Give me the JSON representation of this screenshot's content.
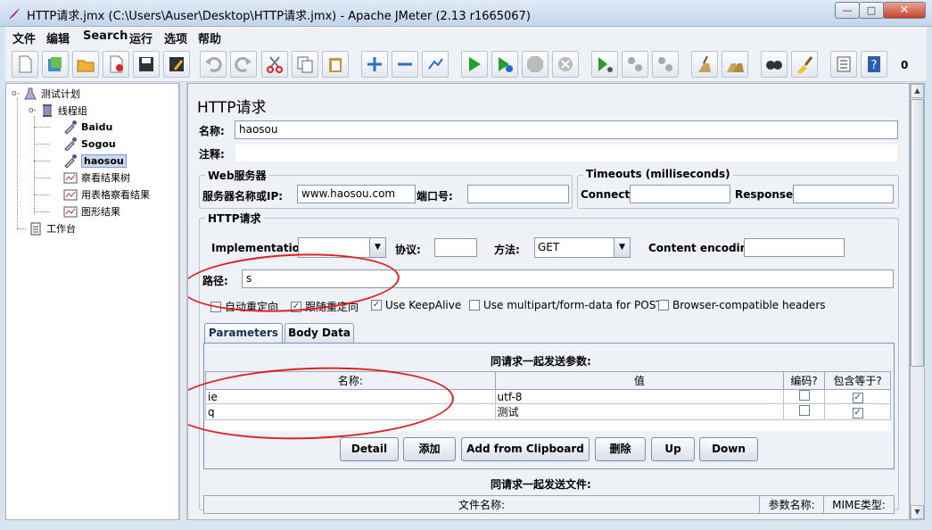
{
  "window": {
    "title": "HTTP请求.jmx (C:\\Users\\Auser\\Desktop\\HTTP请求.jmx) - Apache JMeter (2.13 r1665067)",
    "minimize": "—",
    "maximize": "□",
    "close": "✕"
  },
  "menu": [
    "文件",
    "编辑",
    "Search",
    "运行",
    "选项",
    "帮助"
  ],
  "toolbar": {
    "icons": [
      "new-icon",
      "templates-icon",
      "open-icon",
      "close-icon",
      "save-icon",
      "save-as-icon",
      "undo-icon",
      "redo-icon",
      "cut-icon",
      "copy-icon",
      "paste-icon",
      "expand-icon",
      "collapse-icon",
      "toggle-icon",
      "start-icon",
      "start-no-pause-icon",
      "stop-icon",
      "shutdown-icon",
      "remote-start-icon",
      "remote-stop-icon",
      "remote-shutdown-icon",
      "clear-icon",
      "clear-all-icon",
      "search-icon",
      "reset-search-icon",
      "function-helper-icon",
      "help-icon"
    ],
    "error_count": "0"
  },
  "tree": {
    "test_plan": "测试计划",
    "thread_group": "线程组",
    "samplers": [
      "Baidu",
      "Sogou",
      "haosou"
    ],
    "listeners": [
      "察看结果树",
      "用表格察看结果",
      "图形结果"
    ],
    "workbench": "工作台"
  },
  "panel": {
    "heading": "HTTP请求",
    "name_label": "名称:",
    "name_value": "haosou",
    "comment_label": "注释:",
    "comment_value": "",
    "web_server": {
      "legend": "Web服务器",
      "server_label": "服务器名称或IP:",
      "server_value": "www.haosou.com",
      "port_label": "端口号:",
      "port_value": ""
    },
    "timeouts": {
      "legend": "Timeouts (milliseconds)",
      "connect_label": "Connect:",
      "connect_value": "",
      "response_label": "Response:",
      "response_value": ""
    },
    "http_request": {
      "legend": "HTTP请求",
      "implementation_label": "Implementation:",
      "implementation_value": "",
      "protocol_label": "协议:",
      "protocol_value": "",
      "method_label": "方法:",
      "method_value": "GET",
      "encoding_label": "Content encoding:",
      "encoding_value": "",
      "path_label": "路径:",
      "path_value": "s"
    },
    "options": [
      {
        "label": "自动重定向",
        "checked": false
      },
      {
        "label": "跟随重定向",
        "checked": true
      },
      {
        "label": "Use KeepAlive",
        "checked": true
      },
      {
        "label": "Use multipart/form-data for POST",
        "checked": false
      },
      {
        "label": "Browser-compatible headers",
        "checked": false
      }
    ],
    "tabs": [
      "Parameters",
      "Body Data"
    ],
    "params": {
      "caption": "同请求一起发送参数:",
      "headers": [
        "名称:",
        "值",
        "编码?",
        "包含等于?"
      ],
      "rows": [
        {
          "name": "ie",
          "value": "utf-8",
          "encode": false,
          "include_equals": true
        },
        {
          "name": "q",
          "value": "测试",
          "encode": false,
          "include_equals": true
        }
      ]
    },
    "buttons": [
      "Detail",
      "添加",
      "Add from Clipboard",
      "删除",
      "Up",
      "Down"
    ],
    "files": {
      "caption": "同请求一起发送文件:",
      "headers": [
        "文件名称:",
        "参数名称:",
        "MIME类型:"
      ]
    }
  }
}
